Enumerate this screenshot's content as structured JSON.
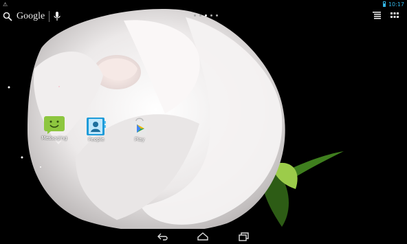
{
  "status": {
    "time": "10:17",
    "warning_icon": "warning-triangle-icon",
    "battery_icon": "battery-icon"
  },
  "search": {
    "label": "Google",
    "search_icon": "search-icon",
    "mic_icon": "mic-icon"
  },
  "page_indicator": {
    "count": 5,
    "active_index": 2
  },
  "top_right": {
    "icons": [
      "widgets-list-icon",
      "app-drawer-grid-icon"
    ]
  },
  "apps": [
    {
      "label": "Messaging",
      "icon": "messaging-icon",
      "color": "#8dc63f"
    },
    {
      "label": "People",
      "icon": "people-icon",
      "color": "#1d9bd9"
    },
    {
      "label": "Play",
      "icon": "play-store-icon",
      "color": "#e8e8e8"
    }
  ],
  "nav": {
    "icons": [
      "back-icon",
      "home-icon",
      "recent-apps-icon"
    ]
  },
  "wallpaper": {
    "subject": "white rose",
    "accent": "#3f7f1e"
  }
}
